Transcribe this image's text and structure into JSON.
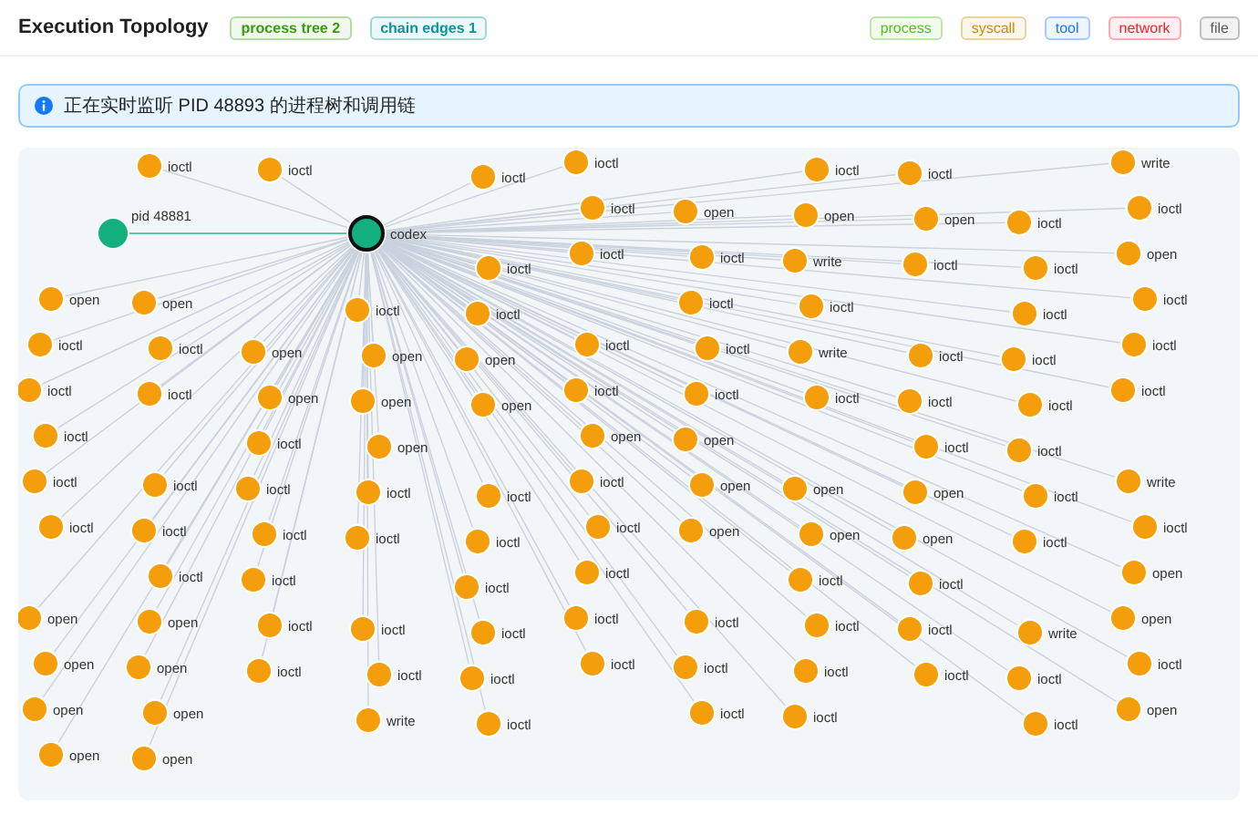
{
  "header": {
    "title": "Execution Topology",
    "badges": [
      {
        "label": "process tree 2",
        "color": "#389e0d"
      },
      {
        "label": "chain edges 1",
        "color": "#08979c"
      }
    ],
    "legend": [
      {
        "label": "process",
        "color": "#52c41a"
      },
      {
        "label": "syscall",
        "color": "#d48806"
      },
      {
        "label": "tool",
        "color": "#1677ff"
      },
      {
        "label": "network",
        "color": "#f5222d"
      },
      {
        "label": "file",
        "color": "#595959"
      }
    ]
  },
  "banner": {
    "text": "正在实时监听 PID 48893 的进程树和调用链"
  },
  "graph": {
    "root": {
      "label": "codex",
      "kind": "process",
      "selected": true
    },
    "processes": [
      {
        "label": "pid 48881",
        "kind": "process"
      }
    ],
    "syscalls": [
      {
        "label": "ioctl",
        "kind": "syscall"
      },
      {
        "label": "ioctl",
        "kind": "syscall"
      },
      {
        "label": "ioctl",
        "kind": "syscall"
      },
      {
        "label": "ioctl",
        "kind": "syscall"
      },
      {
        "label": "ioctl",
        "kind": "syscall"
      },
      {
        "label": "ioctl",
        "kind": "syscall"
      },
      {
        "label": "write",
        "kind": "syscall"
      },
      {
        "label": "ioctl",
        "kind": "syscall"
      },
      {
        "label": "open",
        "kind": "syscall"
      },
      {
        "label": "open",
        "kind": "syscall"
      },
      {
        "label": "open",
        "kind": "syscall"
      },
      {
        "label": "ioctl",
        "kind": "syscall"
      },
      {
        "label": "ioctl",
        "kind": "syscall"
      },
      {
        "label": "ioctl",
        "kind": "syscall"
      },
      {
        "label": "ioctl",
        "kind": "syscall"
      },
      {
        "label": "ioctl",
        "kind": "syscall"
      },
      {
        "label": "write",
        "kind": "syscall"
      },
      {
        "label": "ioctl",
        "kind": "syscall"
      },
      {
        "label": "ioctl",
        "kind": "syscall"
      },
      {
        "label": "open",
        "kind": "syscall"
      },
      {
        "label": "open",
        "kind": "syscall"
      },
      {
        "label": "open",
        "kind": "syscall"
      },
      {
        "label": "ioctl",
        "kind": "syscall"
      },
      {
        "label": "ioctl",
        "kind": "syscall"
      },
      {
        "label": "ioctl",
        "kind": "syscall"
      },
      {
        "label": "ioctl",
        "kind": "syscall"
      },
      {
        "label": "ioctl",
        "kind": "syscall"
      },
      {
        "label": "ioctl",
        "kind": "syscall"
      },
      {
        "label": "ioctl",
        "kind": "syscall"
      },
      {
        "label": "ioctl",
        "kind": "syscall"
      },
      {
        "label": "open",
        "kind": "syscall"
      },
      {
        "label": "open",
        "kind": "syscall"
      },
      {
        "label": "open",
        "kind": "syscall"
      },
      {
        "label": "ioctl",
        "kind": "syscall"
      },
      {
        "label": "ioctl",
        "kind": "syscall"
      },
      {
        "label": "write",
        "kind": "syscall"
      },
      {
        "label": "ioctl",
        "kind": "syscall"
      },
      {
        "label": "ioctl",
        "kind": "syscall"
      },
      {
        "label": "ioctl",
        "kind": "syscall"
      },
      {
        "label": "ioctl",
        "kind": "syscall"
      },
      {
        "label": "ioctl",
        "kind": "syscall"
      },
      {
        "label": "open",
        "kind": "syscall"
      },
      {
        "label": "open",
        "kind": "syscall"
      },
      {
        "label": "open",
        "kind": "syscall"
      },
      {
        "label": "ioctl",
        "kind": "syscall"
      },
      {
        "label": "ioctl",
        "kind": "syscall"
      },
      {
        "label": "ioctl",
        "kind": "syscall"
      },
      {
        "label": "ioctl",
        "kind": "syscall"
      },
      {
        "label": "ioctl",
        "kind": "syscall"
      },
      {
        "label": "ioctl",
        "kind": "syscall"
      },
      {
        "label": "ioctl",
        "kind": "syscall"
      },
      {
        "label": "ioctl",
        "kind": "syscall"
      },
      {
        "label": "open",
        "kind": "syscall"
      },
      {
        "label": "open",
        "kind": "syscall"
      },
      {
        "label": "open",
        "kind": "syscall"
      },
      {
        "label": "ioctl",
        "kind": "syscall"
      },
      {
        "label": "ioctl",
        "kind": "syscall"
      },
      {
        "label": "ioctl",
        "kind": "syscall"
      },
      {
        "label": "ioctl",
        "kind": "syscall"
      },
      {
        "label": "ioctl",
        "kind": "syscall"
      },
      {
        "label": "ioctl",
        "kind": "syscall"
      },
      {
        "label": "ioctl",
        "kind": "syscall"
      },
      {
        "label": "ioctl",
        "kind": "syscall"
      },
      {
        "label": "open",
        "kind": "syscall"
      },
      {
        "label": "open",
        "kind": "syscall"
      },
      {
        "label": "open",
        "kind": "syscall"
      },
      {
        "label": "ioctl",
        "kind": "syscall"
      },
      {
        "label": "write",
        "kind": "syscall"
      },
      {
        "label": "ioctl",
        "kind": "syscall"
      },
      {
        "label": "ioctl",
        "kind": "syscall"
      },
      {
        "label": "ioctl",
        "kind": "syscall"
      },
      {
        "label": "ioctl",
        "kind": "syscall"
      },
      {
        "label": "ioctl",
        "kind": "syscall"
      },
      {
        "label": "ioctl",
        "kind": "syscall"
      },
      {
        "label": "open",
        "kind": "syscall"
      },
      {
        "label": "open",
        "kind": "syscall"
      },
      {
        "label": "open",
        "kind": "syscall"
      },
      {
        "label": "ioctl",
        "kind": "syscall"
      },
      {
        "label": "ioctl",
        "kind": "syscall"
      },
      {
        "label": "ioctl",
        "kind": "syscall"
      },
      {
        "label": "ioctl",
        "kind": "syscall"
      },
      {
        "label": "ioctl",
        "kind": "syscall"
      },
      {
        "label": "ioctl",
        "kind": "syscall"
      },
      {
        "label": "ioctl",
        "kind": "syscall"
      },
      {
        "label": "ioctl",
        "kind": "syscall"
      },
      {
        "label": "open",
        "kind": "syscall"
      },
      {
        "label": "open",
        "kind": "syscall"
      },
      {
        "label": "open",
        "kind": "syscall"
      },
      {
        "label": "ioctl",
        "kind": "syscall"
      },
      {
        "label": "ioctl",
        "kind": "syscall"
      },
      {
        "label": "ioctl",
        "kind": "syscall"
      },
      {
        "label": "ioctl",
        "kind": "syscall"
      },
      {
        "label": "ioctl",
        "kind": "syscall"
      },
      {
        "label": "ioctl",
        "kind": "syscall"
      },
      {
        "label": "ioctl",
        "kind": "syscall"
      },
      {
        "label": "write",
        "kind": "syscall"
      },
      {
        "label": "open",
        "kind": "syscall"
      },
      {
        "label": "open",
        "kind": "syscall"
      },
      {
        "label": "open",
        "kind": "syscall"
      },
      {
        "label": "ioctl",
        "kind": "syscall"
      },
      {
        "label": "ioctl",
        "kind": "syscall"
      },
      {
        "label": "ioctl",
        "kind": "syscall"
      },
      {
        "label": "ioctl",
        "kind": "syscall"
      },
      {
        "label": "ioctl",
        "kind": "syscall"
      },
      {
        "label": "ioctl",
        "kind": "syscall"
      },
      {
        "label": "ioctl",
        "kind": "syscall"
      },
      {
        "label": "ioctl",
        "kind": "syscall"
      },
      {
        "label": "ioctl",
        "kind": "syscall"
      },
      {
        "label": "open",
        "kind": "syscall"
      },
      {
        "label": "open",
        "kind": "syscall"
      },
      {
        "label": "write",
        "kind": "syscall"
      },
      {
        "label": "ioctl",
        "kind": "syscall"
      },
      {
        "label": "ioctl",
        "kind": "syscall"
      },
      {
        "label": "ioctl",
        "kind": "syscall"
      },
      {
        "label": "ioctl",
        "kind": "syscall"
      },
      {
        "label": "open",
        "kind": "syscall"
      },
      {
        "label": "open",
        "kind": "syscall"
      },
      {
        "label": "open",
        "kind": "syscall"
      }
    ]
  }
}
